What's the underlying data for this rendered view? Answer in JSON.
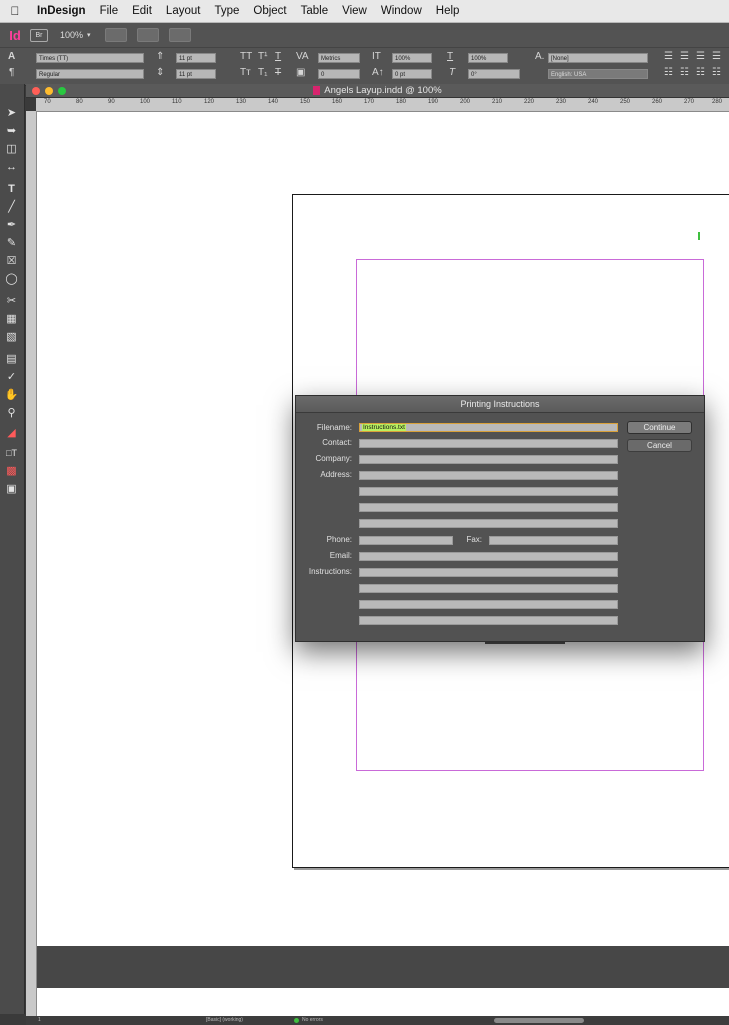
{
  "menubar": {
    "app_name": "InDesign",
    "items": [
      "File",
      "Edit",
      "Layout",
      "Type",
      "Object",
      "Table",
      "View",
      "Window",
      "Help"
    ]
  },
  "appbar": {
    "logo": "Id",
    "mode": "Br",
    "zoom": "100%"
  },
  "control_panel": {
    "font_family": "Times (TT)",
    "font_style": "Regular",
    "font_size": "11 pt",
    "leading": "11 pt",
    "kerning": "Metrics",
    "tracking": "0",
    "vertical_scale": "100%",
    "horizontal_scale": "100%",
    "baseline_shift": "0 pt",
    "skew": "0°",
    "character_style": "[None]",
    "language": "English: USA"
  },
  "document": {
    "title": "Angels Layup.indd @ 100%"
  },
  "ruler": {
    "ticks": [
      "70",
      "80",
      "90",
      "100",
      "110",
      "120",
      "130",
      "140",
      "150",
      "160",
      "170",
      "180",
      "190",
      "200",
      "210",
      "220",
      "230",
      "240",
      "250",
      "260",
      "270",
      "280"
    ]
  },
  "dialog": {
    "title": "Printing Instructions",
    "labels": {
      "filename": "Filename:",
      "contact": "Contact:",
      "company": "Company:",
      "address": "Address:",
      "phone": "Phone:",
      "fax": "Fax:",
      "email": "Email:",
      "instructions": "Instructions:"
    },
    "filename_value": "Instructions.txt",
    "continue_label": "Continue",
    "cancel_label": "Cancel"
  },
  "statusbar": {
    "page": "1",
    "preflight_profile": "[Basic] (working)",
    "errors": "No errors"
  },
  "colors": {
    "accent_magenta": "#ff3f9d",
    "margin_guide": "#c96ad8",
    "preflight_ok": "#3fbf3f",
    "focus_ring": "#d9a13a",
    "selection_highlight": "#b8f060"
  }
}
